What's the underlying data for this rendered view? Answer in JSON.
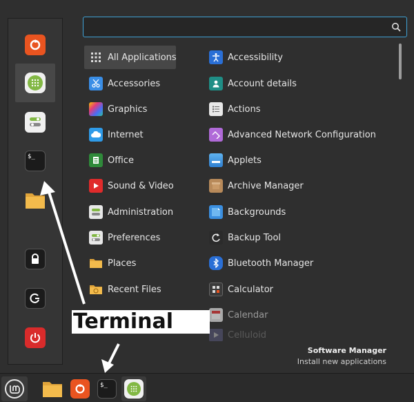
{
  "search": {
    "value": "",
    "placeholder": ""
  },
  "favorites": [
    {
      "name": "firefox-icon"
    },
    {
      "name": "software-manager-icon"
    },
    {
      "name": "settings-icon"
    },
    {
      "name": "terminal-icon",
      "text": "$_"
    },
    {
      "name": "folder-icon"
    },
    {
      "name": "lock-icon"
    },
    {
      "name": "logout-icon"
    },
    {
      "name": "power-icon"
    }
  ],
  "categories": [
    {
      "label": "All Applications",
      "icon": "grid-icon"
    },
    {
      "label": "Accessories",
      "icon": "scissors-icon"
    },
    {
      "label": "Graphics",
      "icon": "color-icon"
    },
    {
      "label": "Internet",
      "icon": "cloud-icon"
    },
    {
      "label": "Office",
      "icon": "document-icon"
    },
    {
      "label": "Sound & Video",
      "icon": "play-icon"
    },
    {
      "label": "Administration",
      "icon": "admin-icon"
    },
    {
      "label": "Preferences",
      "icon": "toggle-icon"
    },
    {
      "label": "Places",
      "icon": "folder-icon"
    },
    {
      "label": "Recent Files",
      "icon": "recent-folder-icon"
    }
  ],
  "applications": [
    {
      "label": "Accessibility",
      "icon": "accessibility-icon"
    },
    {
      "label": "Account details",
      "icon": "account-icon"
    },
    {
      "label": "Actions",
      "icon": "list-icon"
    },
    {
      "label": "Advanced Network Configuration",
      "icon": "network-icon"
    },
    {
      "label": "Applets",
      "icon": "applets-icon"
    },
    {
      "label": "Archive Manager",
      "icon": "archive-icon"
    },
    {
      "label": "Backgrounds",
      "icon": "backgrounds-icon"
    },
    {
      "label": "Backup Tool",
      "icon": "backup-icon"
    },
    {
      "label": "Bluetooth Manager",
      "icon": "bluetooth-icon"
    },
    {
      "label": "Calculator",
      "icon": "calculator-icon"
    },
    {
      "label": "Calendar",
      "icon": "calendar-icon"
    },
    {
      "label": "Celluloid",
      "icon": "celluloid-icon"
    }
  ],
  "info": {
    "title": "Software Manager",
    "description": "Install new applications"
  },
  "panel": {
    "terminal_text": "$_"
  },
  "annotation": {
    "text": "Terminal"
  },
  "colors": {
    "accent": "#3fa2d6",
    "orange": "#e95420",
    "green": "#82b844",
    "red": "#d92b2b"
  }
}
